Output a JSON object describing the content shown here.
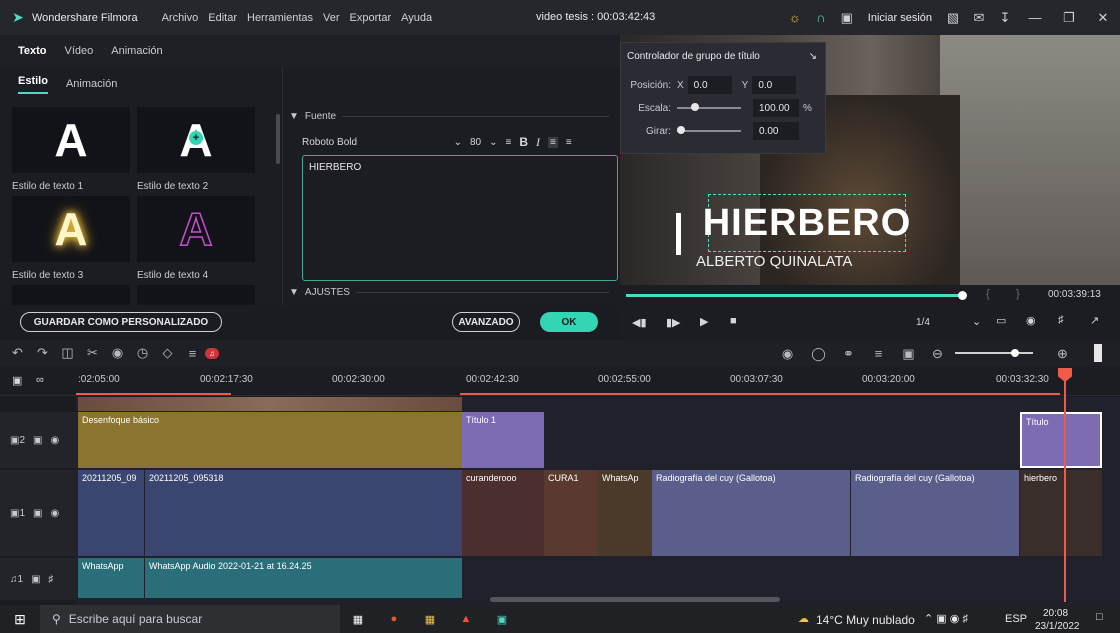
{
  "app": {
    "title": "Wondershare Filmora",
    "menu": [
      "Archivo",
      "Editar",
      "Herramientas",
      "Ver",
      "Exportar",
      "Ayuda"
    ],
    "project": "video tesis : 00:03:42:43",
    "signin": "Iniciar sesión"
  },
  "editor_tabs": [
    "Texto",
    "Vídeo",
    "Animación"
  ],
  "sub_tabs": [
    "Estilo",
    "Animación"
  ],
  "text_styles": [
    {
      "label": "Estilo de texto 1"
    },
    {
      "label": "Estilo de texto 2"
    },
    {
      "label": "Estilo de texto 3"
    },
    {
      "label": "Estilo de texto 4"
    }
  ],
  "font": {
    "section": "Fuente",
    "name": "Roboto Bold",
    "size": "80",
    "text": "HIERBERO",
    "adjust_section": "AJUSTES"
  },
  "buttons": {
    "save_custom": "GUARDAR COMO PERSONALIZADO",
    "advanced": "AVANZADO",
    "ok": "OK"
  },
  "group_controller": {
    "title": "Controlador de grupo de título",
    "pos_label": "Posición:",
    "x_label": "X",
    "x_value": "0.0",
    "y_label": "Y",
    "y_value": "0.0",
    "scale_label": "Escala:",
    "scale_value": "100.00",
    "scale_unit": "%",
    "rotate_label": "Girar:",
    "rotate_value": "0.00"
  },
  "preview": {
    "title_text": "HIERBERO",
    "subtitle": "ALBERTO QUINALATA",
    "timecode": "00:03:39:13",
    "page": "1/4"
  },
  "ruler": [
    ":02:05:00",
    "00:02:17:30",
    "00:02:30:00",
    "00:02:42:30",
    "00:02:55:00",
    "00:03:07:30",
    "00:03:20:00",
    "00:03:32:30"
  ],
  "tracks": {
    "t2_clips": [
      "Desenfoque básico",
      "Título 1",
      "Título"
    ],
    "t1_clips": [
      "20211205_09",
      "20211205_095318",
      "curanderooo",
      "CURA1",
      "WhatsAp",
      "Radiografía del cuy (Gallotoa)",
      "Radiografía del cuy (Gallotoa)",
      "hierbero"
    ],
    "audio_clips": [
      "WhatsApp",
      "WhatsApp Audio 2022-01-21 at 16.24.25"
    ]
  },
  "taskbar": {
    "search": "Escribe aquí para buscar",
    "weather": "14°C  Muy nublado",
    "lang": "ESP",
    "time": "20:08",
    "date": "23/1/2022"
  },
  "colors": {
    "accent": "#4ddbc4",
    "playhead": "#f05a4a",
    "effect_clip": "#8a7430",
    "title_clip": "#7d6bb3",
    "video_clip": "#3a4670",
    "audio_clip": "#2a6e7a"
  }
}
